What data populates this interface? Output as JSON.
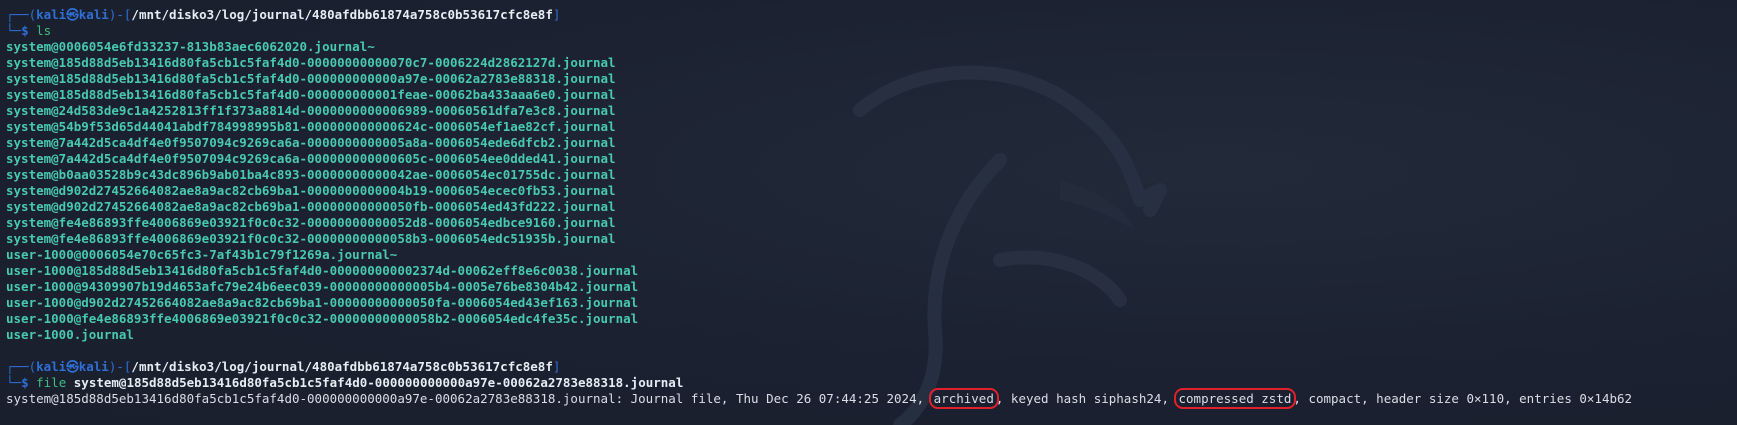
{
  "prompt": {
    "line_prefix": "┌──(",
    "user": "kali",
    "at": "㉿",
    "host": "kali",
    "sep": ")-[",
    "close": "]",
    "dollar_prefix": "└─",
    "dollar": "$"
  },
  "command1": {
    "path": "/mnt/disko3/log/journal/480afdbb61874a758c0b53617cfc8e8f",
    "cmd": "ls"
  },
  "files": [
    "system@0006054e6fd33237-813b83aec6062020.journal~",
    "system@185d88d5eb13416d80fa5cb1c5faf4d0-00000000000070c7-0006224d2862127d.journal",
    "system@185d88d5eb13416d80fa5cb1c5faf4d0-000000000000a97e-00062a2783e88318.journal",
    "system@185d88d5eb13416d80fa5cb1c5faf4d0-000000000001feae-00062ba433aaa6e0.journal",
    "system@24d583de9c1a4252813ff1f373a8814d-0000000000006989-00060561dfa7e3c8.journal",
    "system@54b9f53d65d44041abdf784998995b81-000000000000624c-0006054ef1ae82cf.journal",
    "system@7a442d5ca4df4e0f9507094c9269ca6a-0000000000005a8a-0006054ede6dfcb2.journal",
    "system@7a442d5ca4df4e0f9507094c9269ca6a-000000000000605c-0006054ee0dded41.journal",
    "system@b0aa03528b9c43dc896b9ab01ba4c893-00000000000042ae-0006054ec01755dc.journal",
    "system@d902d27452664082ae8a9ac82cb69ba1-0000000000004b19-0006054ecec0fb53.journal",
    "system@d902d27452664082ae8a9ac82cb69ba1-00000000000050fb-0006054ed43fd222.journal",
    "system@fe4e86893ffe4006869e03921f0c0c32-00000000000052d8-0006054edbce9160.journal",
    "system@fe4e86893ffe4006869e03921f0c0c32-00000000000058b3-0006054edc51935b.journal",
    "user-1000@0006054e70c65fc3-7af43b1c79f1269a.journal~",
    "user-1000@185d88d5eb13416d80fa5cb1c5faf4d0-000000000002374d-00062eff8e6c0038.journal",
    "user-1000@94309907b19d4653afc79e24b6eec039-00000000000005b4-0005e76be8304b42.journal",
    "user-1000@d902d27452664082ae8a9ac82cb69ba1-00000000000050fa-0006054ed43ef163.journal",
    "user-1000@fe4e86893ffe4006869e03921f0c0c32-00000000000058b2-0006054edc4fe35c.journal",
    "user-1000.journal"
  ],
  "command2": {
    "path": "/mnt/disko3/log/journal/480afdbb61874a758c0b53617cfc8e8f",
    "cmd": "file",
    "arg": "system@185d88d5eb13416d80fa5cb1c5faf4d0-000000000000a97e-00062a2783e88318.journal"
  },
  "file_output": {
    "prefix": "system@185d88d5eb13416d80fa5cb1c5faf4d0-000000000000a97e-00062a2783e88318.journal: Journal file, Thu Dec 26 07:44:25 2024, ",
    "highlight1": "archived",
    "middle": ", keyed hash siphash24, ",
    "highlight2": "compressed zstd",
    "suffix": ", compact, header size 0×110, entries 0×14b62"
  },
  "colors": {
    "background": "#1c2230",
    "prompt_blue": "#2f6fd6",
    "command_green": "#3fbf7f",
    "file_teal": "#48c9b0",
    "highlight_red": "#e0202a"
  }
}
